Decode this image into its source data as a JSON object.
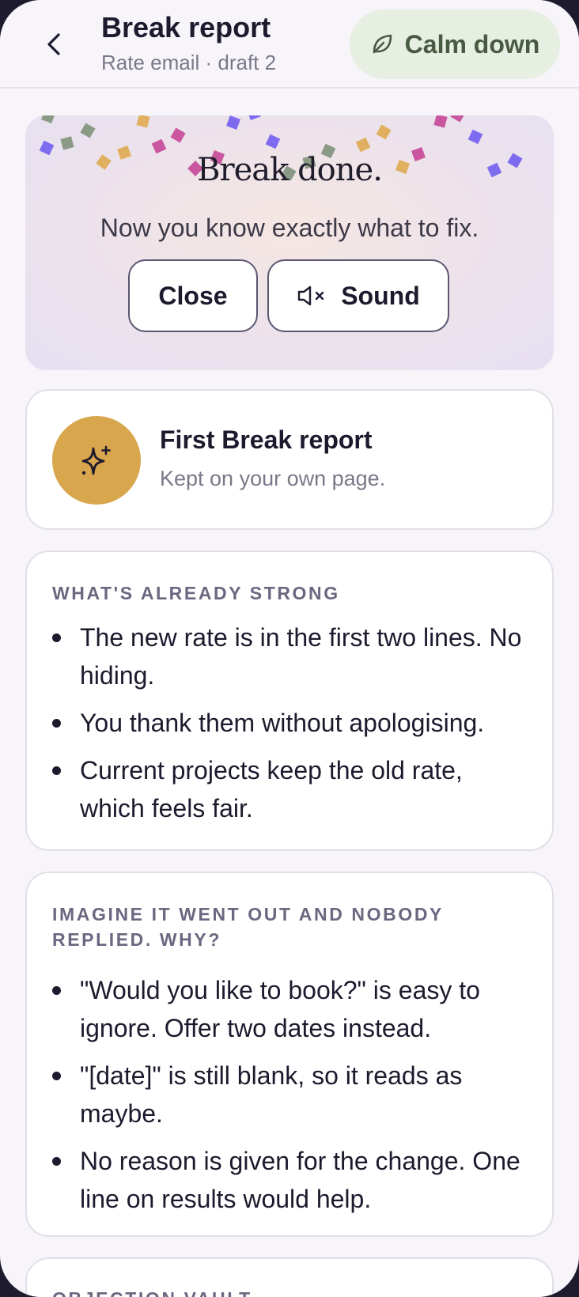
{
  "header": {
    "title": "Break report",
    "subtitle": "Rate email · draft 2",
    "calm_label": "Calm down"
  },
  "celebration": {
    "title": "Break done.",
    "subtitle": "Now you know exactly what to fix.",
    "close_label": "Close",
    "sound_label": "Sound"
  },
  "achievement": {
    "title": "First Break report",
    "subtitle": "Kept on your own page."
  },
  "sections": [
    {
      "label": "WHAT'S ALREADY STRONG",
      "items": [
        "The new rate is in the first two lines. No hiding.",
        "You thank them without apologising.",
        "Current projects keep the old rate, which feels fair."
      ]
    },
    {
      "label": "IMAGINE IT WENT OUT AND NOBODY REPLIED. WHY?",
      "items": [
        "\"Would you like to book?\" is easy to ignore. Offer two dates instead.",
        "\"[date]\" is still blank, so it reads as maybe.",
        "No reason is given for the change. One line on results would help."
      ]
    },
    {
      "label": "OBJECTION VAULT"
    }
  ],
  "icons": {
    "back": "chevron-left-icon",
    "calm": "leaf-icon",
    "sound": "speaker-muted-icon",
    "badge": "sparkle-icon"
  },
  "colors": {
    "background": "#f7f5fa",
    "calm_button": "#e7eee2",
    "badge": "#d8a64c",
    "text": "#1d1a2e"
  }
}
